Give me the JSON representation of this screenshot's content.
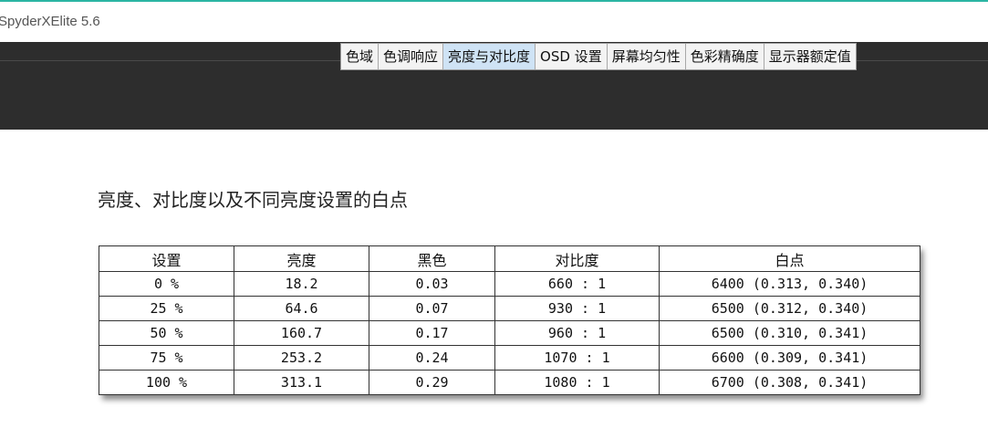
{
  "window": {
    "title": "SpyderXElite 5.6"
  },
  "tabs": [
    {
      "label": "色域",
      "active": false
    },
    {
      "label": "色调响应",
      "active": false
    },
    {
      "label": "亮度与对比度",
      "active": true
    },
    {
      "label": "OSD 设置",
      "active": false
    },
    {
      "label": "屏幕均匀性",
      "active": false
    },
    {
      "label": "色彩精确度",
      "active": false
    },
    {
      "label": "显示器额定值",
      "active": false
    }
  ],
  "section": {
    "heading": "亮度、对比度以及不同亮度设置的白点"
  },
  "table": {
    "headers": [
      "设置",
      "亮度",
      "黑色",
      "对比度",
      "白点"
    ],
    "rows": [
      [
        "0 %",
        "18.2",
        "0.03",
        "660 : 1",
        "6400 (0.313, 0.340)"
      ],
      [
        "25 %",
        "64.6",
        "0.07",
        "930 : 1",
        "6500 (0.312, 0.340)"
      ],
      [
        "50 %",
        "160.7",
        "0.17",
        "960 : 1",
        "6500 (0.310, 0.341)"
      ],
      [
        "75 %",
        "253.2",
        "0.24",
        "1070 : 1",
        "6600 (0.309, 0.341)"
      ],
      [
        "100 %",
        "313.1",
        "0.29",
        "1080 : 1",
        "6700 (0.308, 0.341)"
      ]
    ]
  },
  "colors": {
    "accent": "#2bb5a3",
    "band": "#2d2d2d",
    "active_tab": "#cfe3f5"
  }
}
